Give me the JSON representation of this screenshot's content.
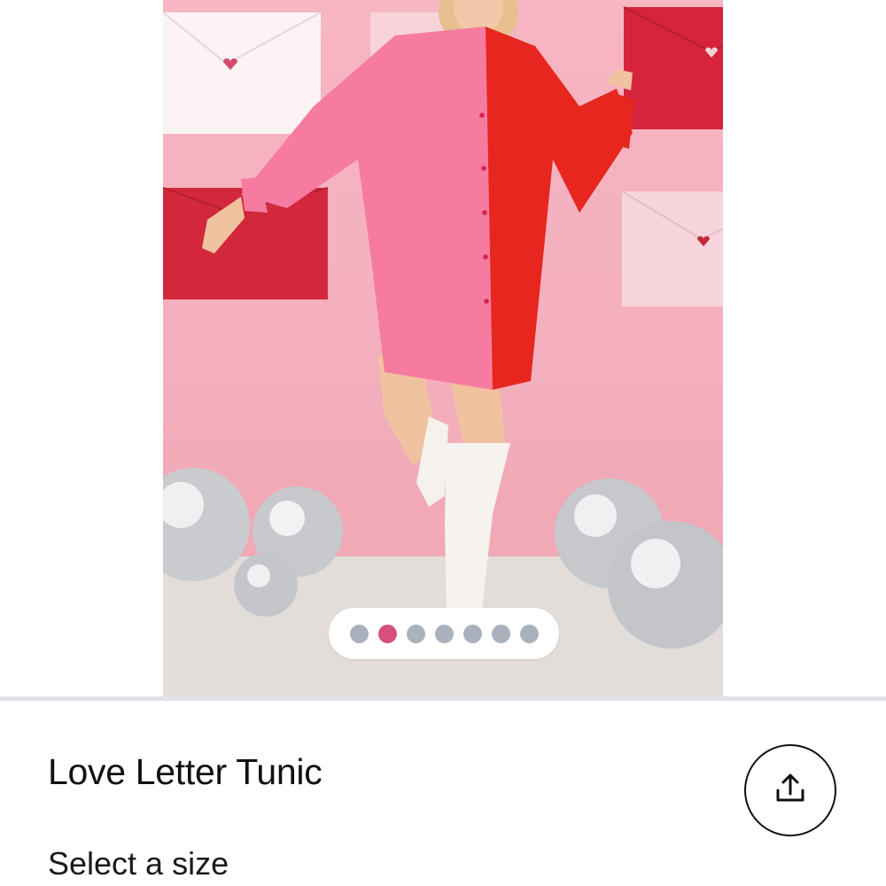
{
  "product": {
    "title": "Love Letter Tunic",
    "image_alt": "Model wearing pink and red color-block shirt dress with white boots"
  },
  "gallery": {
    "dot_count": 7,
    "active_index": 1,
    "active_color": "#d7507c",
    "inactive_color": "#a9b1bd"
  },
  "size": {
    "label": "Select a size"
  },
  "icons": {
    "share": "share-upload-icon"
  }
}
